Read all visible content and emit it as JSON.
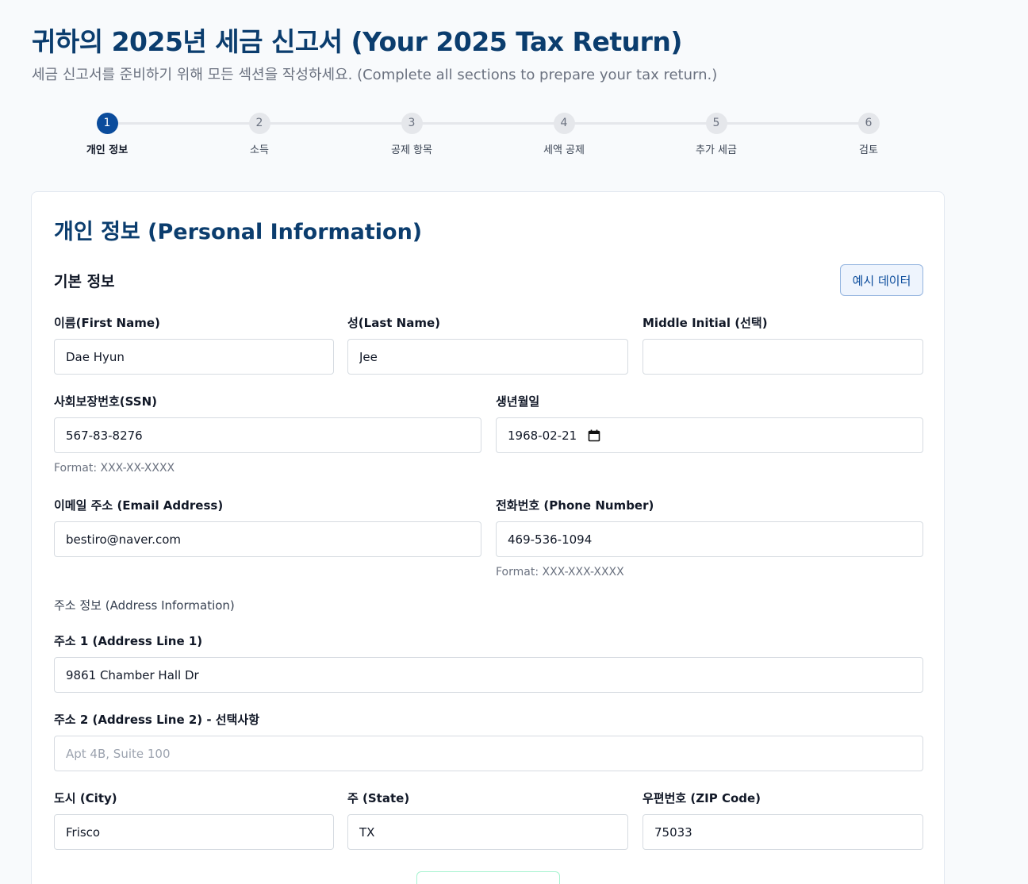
{
  "header": {
    "title": "귀하의 2025년 세금 신고서 (Your 2025 Tax Return)",
    "subtitle": "세금 신고서를 준비하기 위해 모든 섹션을 작성하세요. (Complete all sections to prepare your tax return.)"
  },
  "stepper": {
    "steps": [
      {
        "number": "1",
        "label": "개인 정보"
      },
      {
        "number": "2",
        "label": "소득"
      },
      {
        "number": "3",
        "label": "공제 항목"
      },
      {
        "number": "4",
        "label": "세액 공제"
      },
      {
        "number": "5",
        "label": "추가 세금"
      },
      {
        "number": "6",
        "label": "검토"
      }
    ],
    "active_index": 0
  },
  "card": {
    "title": "개인 정보 (Personal Information)",
    "section_title": "기본 정보",
    "example_button": "예시 데이터"
  },
  "fields": {
    "first_name": {
      "label": "이름(First Name)",
      "value": "Dae Hyun"
    },
    "last_name": {
      "label": "성(Last Name)",
      "value": "Jee"
    },
    "middle_initial": {
      "label": "Middle Initial (선택)",
      "value": ""
    },
    "ssn": {
      "label": "사회보장번호(SSN)",
      "value": "567-83-8276",
      "hint": "Format: XXX-XX-XXXX"
    },
    "dob": {
      "label": "생년월일",
      "value": "1968-02-21"
    },
    "email": {
      "label": "이메일 주소 (Email Address)",
      "value": "bestiro@naver.com"
    },
    "phone": {
      "label": "전화번호 (Phone Number)",
      "value": "469-536-1094",
      "hint": "Format: XXX-XXX-XXXX"
    },
    "address_heading": "주소 정보 (Address Information)",
    "address1": {
      "label": "주소 1 (Address Line 1)",
      "value": "9861 Chamber Hall Dr"
    },
    "address2": {
      "label": "주소 2 (Address Line 2) - 선택사항",
      "value": "",
      "placeholder": "Apt 4B, Suite 100"
    },
    "city": {
      "label": "도시 (City)",
      "value": "Frisco"
    },
    "state": {
      "label": "주 (State)",
      "value": "TX"
    },
    "zip": {
      "label": "우편번호 (ZIP Code)",
      "value": "75033"
    }
  },
  "colors": {
    "brand": "#0b3d6e",
    "accent": "#0b4c9c",
    "background": "#f8fafc"
  }
}
